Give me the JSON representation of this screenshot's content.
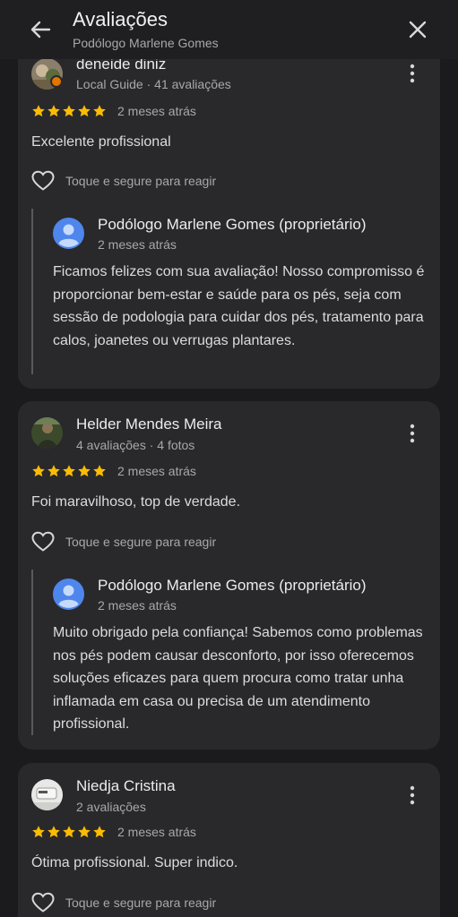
{
  "header": {
    "title": "Avaliações",
    "subtitle": "Podólogo Marlene Gomes",
    "back_icon": "arrow-back-icon",
    "close_icon": "close-icon"
  },
  "colors": {
    "star": "#fbbc04",
    "badge": "#e37400",
    "owner_avatar_bg": "#4f86ec",
    "card_bg": "#29292b",
    "page_bg": "#1b1b1d"
  },
  "reviews": [
    {
      "name": "deneide diniz",
      "meta": "Local Guide · 41 avaliações",
      "rating": 5,
      "date": "2 meses atrás",
      "text": "Excelente profissional",
      "react_label": "Toque e segure para reagir",
      "reply": {
        "owner": "Podólogo Marlene Gomes (proprietário)",
        "date": "2 meses atrás",
        "text": "Ficamos felizes com sua avaliação! Nosso compromisso é proporcionar bem-estar e saúde para os pés, seja com sessão de podologia para cuidar dos pés, tratamento para calos, joanetes ou verrugas plantares."
      }
    },
    {
      "name": "Helder Mendes Meira",
      "meta": "4 avaliações · 4 fotos",
      "rating": 5,
      "date": "2 meses atrás",
      "text": "Foi maravilhoso, top de verdade.",
      "react_label": "Toque e segure para reagir",
      "reply": {
        "owner": "Podólogo Marlene Gomes (proprietário)",
        "date": "2 meses atrás",
        "text": "Muito obrigado pela confiança! Sabemos como problemas nos pés podem causar desconforto, por isso oferecemos soluções eficazes para quem procura como tratar unha inflamada em casa ou precisa de um atendimento profissional."
      }
    },
    {
      "name": "Niedja Cristina",
      "meta": "2 avaliações",
      "rating": 5,
      "date": "2 meses atrás",
      "text": "Ótima profissional. Super indico.",
      "react_label": "Toque e segure para reagir"
    }
  ]
}
